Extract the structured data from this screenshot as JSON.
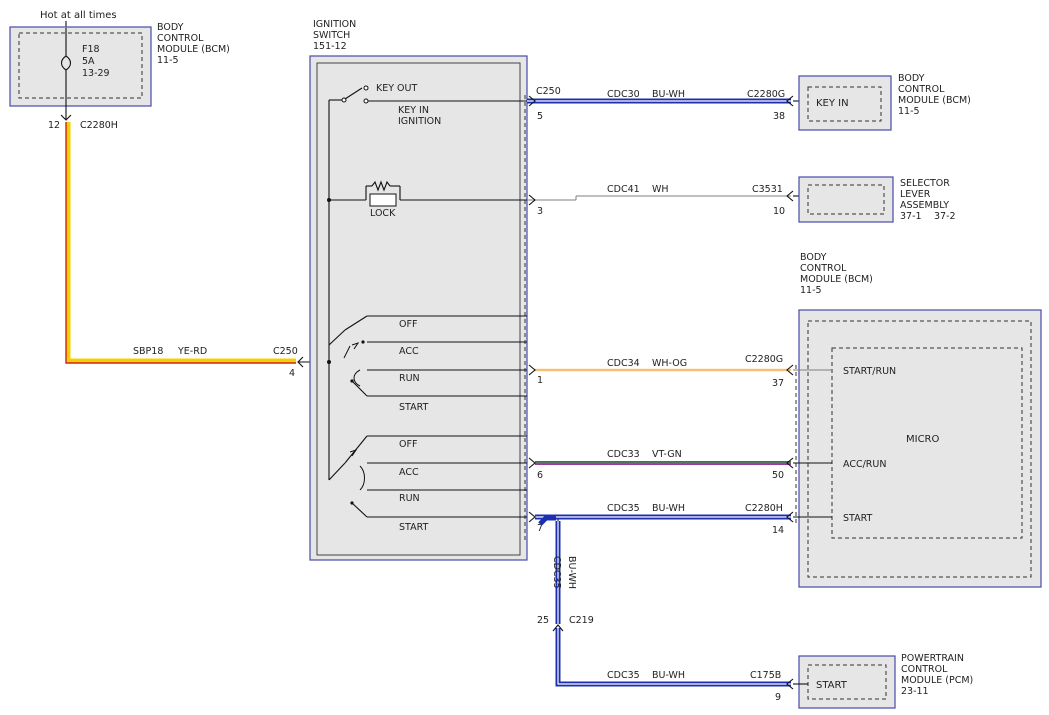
{
  "top": {
    "hot_label": "Hot at all times",
    "bcm_top": [
      "BODY",
      "CONTROL",
      "MODULE (BCM)",
      "11-5"
    ],
    "fuse": [
      "F18",
      "5A",
      "13-29"
    ],
    "pin_12": "12",
    "c2280h_top": "C2280H"
  },
  "ignition_switch": {
    "title": [
      "IGNITION",
      "SWITCH",
      "151-12"
    ],
    "key_out": "KEY OUT",
    "key_in": [
      "KEY IN",
      "IGNITION"
    ],
    "lock": "LOCK",
    "positions_a": [
      "OFF",
      "ACC",
      "RUN",
      "START"
    ],
    "positions_b": [
      "OFF",
      "ACC",
      "RUN",
      "START"
    ]
  },
  "left_wire": {
    "circuit": "SBP18",
    "color": "YE-RD",
    "connector": "C250",
    "pin": "4"
  },
  "circuits": [
    {
      "left_connector": "C250",
      "left_pin": "5",
      "circuit": "CDC30",
      "color": "BU-WH",
      "right_connector": "C2280G",
      "right_pin": "38"
    },
    {
      "left_connector": "",
      "left_pin": "3",
      "circuit": "CDC41",
      "color": "WH",
      "right_connector": "C3531",
      "right_pin": "10"
    },
    {
      "left_connector": "",
      "left_pin": "1",
      "circuit": "CDC34",
      "color": "WH-OG",
      "right_connector": "C2280G",
      "right_pin": "37"
    },
    {
      "left_connector": "",
      "left_pin": "6",
      "circuit": "CDC33",
      "color": "VT-GN",
      "right_connector": "",
      "right_pin": "50"
    },
    {
      "left_connector": "",
      "left_pin": "7",
      "circuit": "CDC35",
      "color": "BU-WH",
      "right_connector": "C2280H",
      "right_pin": "14"
    }
  ],
  "vertical_branch": {
    "circuit": "CDC35",
    "color": "BU-WH",
    "pin": "25",
    "connector": "C219"
  },
  "pcm_circuit": {
    "circuit": "CDC35",
    "color": "BU-WH",
    "connector": "C175B",
    "pin": "9"
  },
  "modules": {
    "bcm_keyin": {
      "title": [
        "BODY",
        "CONTROL",
        "MODULE (BCM)",
        "11-5"
      ],
      "inner": "KEY IN"
    },
    "selector": {
      "title": [
        "SELECTOR",
        "LEVER",
        "ASSEMBLY"
      ],
      "ref1": "37-1",
      "ref2": "37-2"
    },
    "bcm_main": {
      "title": [
        "BODY",
        "CONTROL",
        "MODULE (BCM)",
        "11-5"
      ],
      "micro": "MICRO",
      "start_run": "START/RUN",
      "acc_run": "ACC/RUN",
      "start": "START"
    },
    "pcm": {
      "title": [
        "POWERTRAIN",
        "CONTROL",
        "MODULE (PCM)",
        "23-11"
      ],
      "inner": "START"
    }
  },
  "wire_colors": {
    "yellow": "#f5d000",
    "red": "#d42020",
    "blue": "#1d2fb0",
    "white": "#ffffff",
    "orange": "#f0a030",
    "violet": "#9a3aa0",
    "green": "#2a9a3a"
  }
}
